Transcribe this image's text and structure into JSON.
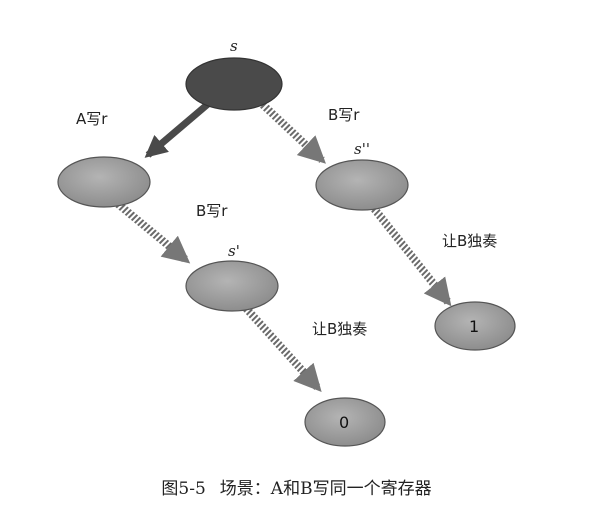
{
  "diagram": {
    "nodes": {
      "root": {
        "label": "s"
      },
      "a": {
        "label": ""
      },
      "b": {
        "label": "s''"
      },
      "c": {
        "label": "s'"
      },
      "leaf0": {
        "label": "0"
      },
      "leaf1": {
        "label": "1"
      }
    },
    "edges": {
      "root_a": {
        "label": "A写r",
        "style": "solid"
      },
      "root_b": {
        "label": "B写r",
        "style": "hatched"
      },
      "a_c": {
        "label": "B写r",
        "style": "hatched"
      },
      "c_leaf0": {
        "label": "让B独奏",
        "style": "hatched"
      },
      "b_leaf1": {
        "label": "让B独奏",
        "style": "hatched"
      }
    },
    "colors": {
      "root_fill": "#4a4a4a",
      "node_fill": "#9a9a9a",
      "edge": "#555555"
    }
  },
  "caption": {
    "figure": "图5-5",
    "text": "场景：A和B写同一个寄存器"
  }
}
